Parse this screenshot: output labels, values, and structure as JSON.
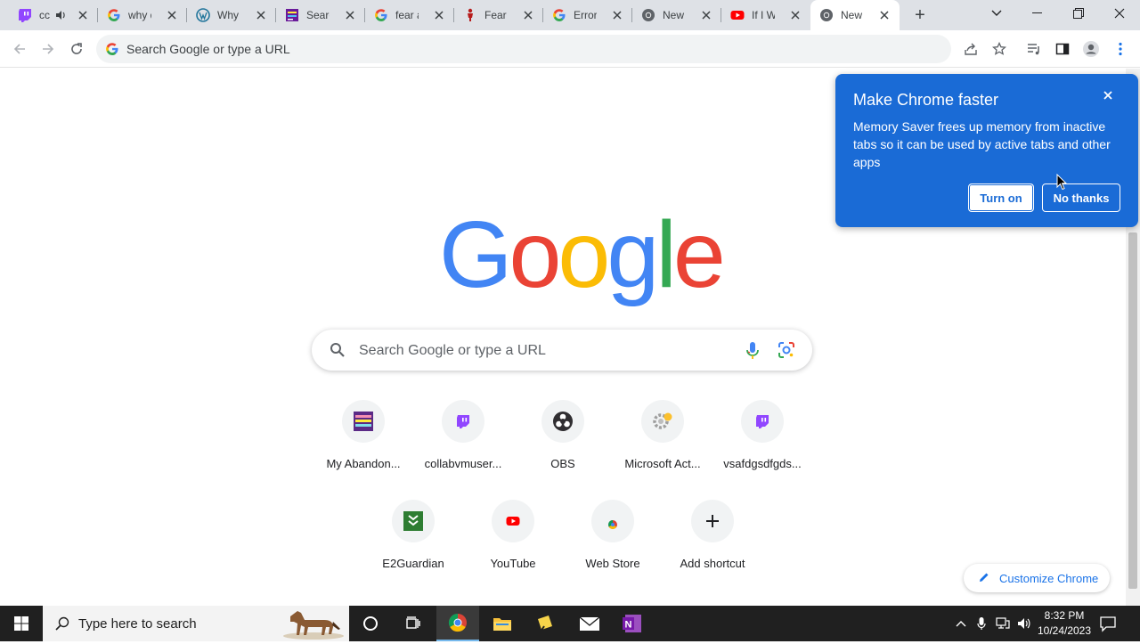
{
  "tabs": [
    {
      "title": "cc",
      "favicon": "twitch-icon",
      "muted_icon": true
    },
    {
      "title": "why d",
      "favicon": "google-icon"
    },
    {
      "title": "Why D",
      "favicon": "wordpress-icon"
    },
    {
      "title": "Searcl",
      "favicon": "site-icon"
    },
    {
      "title": "fear a",
      "favicon": "google-icon"
    },
    {
      "title": "Fear a",
      "favicon": "figure-icon"
    },
    {
      "title": "Error -",
      "favicon": "google-icon"
    },
    {
      "title": "New T",
      "favicon": "chrome-icon"
    },
    {
      "title": "If I We",
      "favicon": "youtube-icon"
    },
    {
      "title": "New T",
      "favicon": "chrome-icon",
      "active": true
    }
  ],
  "omnibox": {
    "placeholder": "Search Google or type a URL"
  },
  "logo": {
    "letters": [
      "G",
      "o",
      "o",
      "g",
      "l",
      "e"
    ],
    "colors": [
      "#4285f4",
      "#ea4335",
      "#fbbc05",
      "#4285f4",
      "#34a853",
      "#ea4335"
    ]
  },
  "search": {
    "placeholder": "Search Google or type a URL"
  },
  "shortcuts": [
    {
      "label": "My Abandon...",
      "icon": "abandonware-icon"
    },
    {
      "label": "collabvmuser...",
      "icon": "twitch-icon"
    },
    {
      "label": "OBS",
      "icon": "obs-icon"
    },
    {
      "label": "Microsoft Act...",
      "icon": "gear-icon"
    },
    {
      "label": "vsafdgsdfgds...",
      "icon": "twitch-icon"
    },
    {
      "label": "E2Guardian",
      "icon": "e2guardian-icon"
    },
    {
      "label": "YouTube",
      "icon": "youtube-icon"
    },
    {
      "label": "Web Store",
      "icon": "webstore-icon"
    },
    {
      "label": "Add shortcut",
      "icon": "plus-icon"
    }
  ],
  "customize": {
    "label": "Customize Chrome"
  },
  "popup": {
    "title": "Make Chrome faster",
    "body": "Memory Saver frees up memory from inactive tabs so it can be used by active tabs and other apps",
    "turn_on": "Turn on",
    "no_thanks": "No thanks"
  },
  "taskbar": {
    "search_placeholder": "Type here to search",
    "time": "8:32 PM",
    "date": "10/24/2023"
  },
  "colors": {
    "popup_bg": "#1a6bd6",
    "accent": "#1a73e8",
    "tabstrip": "#dee1e6"
  }
}
